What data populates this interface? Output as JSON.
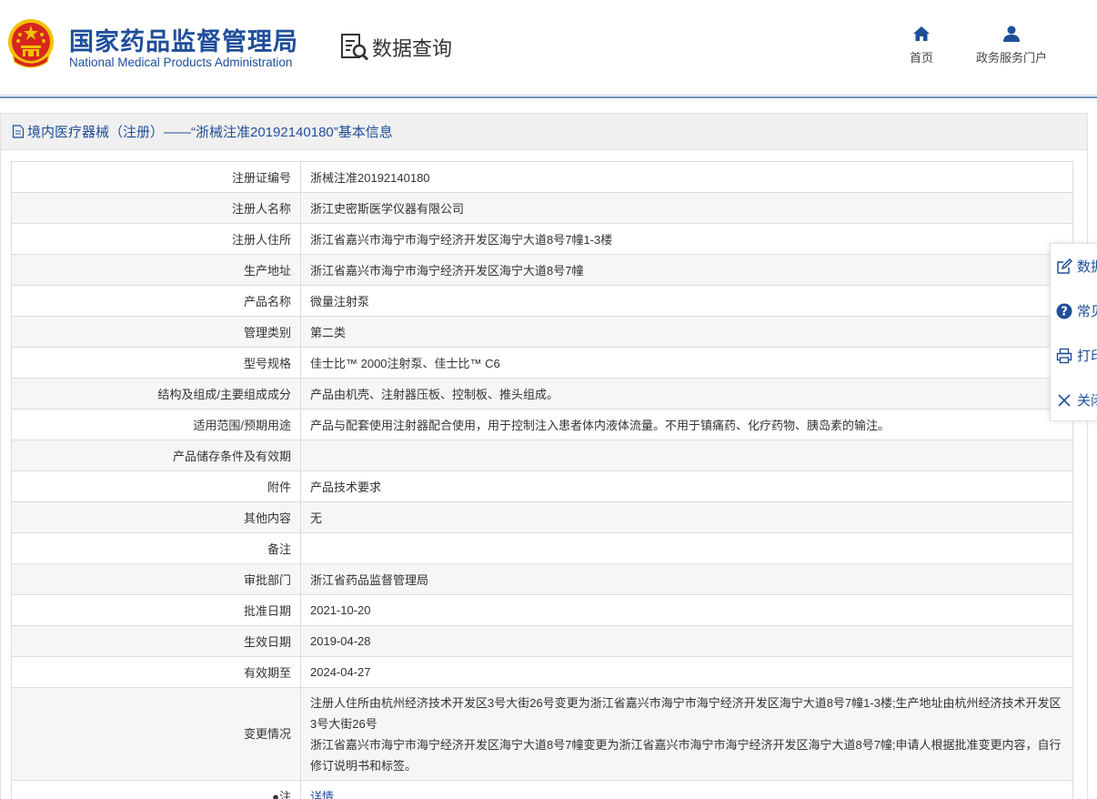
{
  "header": {
    "org_cn": "国家药品监督管理局",
    "org_en": "National Medical Products Administration",
    "query_label": "数据查询",
    "nav": [
      {
        "label": "首页",
        "icon": "home-icon"
      },
      {
        "label": "政务服务门户",
        "icon": "user-icon"
      }
    ]
  },
  "panel": {
    "title": "境内医疗器械（注册）——“浙械注准20192140180”基本信息"
  },
  "rows": [
    {
      "label": "注册证编号",
      "value": "浙械注准20192140180"
    },
    {
      "label": "注册人名称",
      "value": "浙江史密斯医学仪器有限公司"
    },
    {
      "label": "注册人住所",
      "value": "浙江省嘉兴市海宁市海宁经济开发区海宁大道8号7幢1-3楼"
    },
    {
      "label": "生产地址",
      "value": "浙江省嘉兴市海宁市海宁经济开发区海宁大道8号7幢"
    },
    {
      "label": "产品名称",
      "value": "微量注射泵"
    },
    {
      "label": "管理类别",
      "value": "第二类"
    },
    {
      "label": "型号规格",
      "value": "佳士比™ 2000注射泵、佳士比™ C6"
    },
    {
      "label": "结构及组成/主要组成成分",
      "value": "产品由机壳、注射器压板、控制板、推头组成。"
    },
    {
      "label": "适用范围/预期用途",
      "value": "产品与配套使用注射器配合使用，用于控制注入患者体内液体流量。不用于镇痛药、化疗药物、胰岛素的输注。"
    },
    {
      "label": "产品储存条件及有效期",
      "value": ""
    },
    {
      "label": "附件",
      "value": "产品技术要求"
    },
    {
      "label": "其他内容",
      "value": "无"
    },
    {
      "label": "备注",
      "value": ""
    },
    {
      "label": "审批部门",
      "value": "浙江省药品监督管理局"
    },
    {
      "label": "批准日期",
      "value": "2021-10-20"
    },
    {
      "label": "生效日期",
      "value": "2019-04-28"
    },
    {
      "label": "有效期至",
      "value": "2024-04-27"
    }
  ],
  "change": {
    "label": "变更情况",
    "line1": "注册人住所由杭州经济技术开发区3号大街26号变更为浙江省嘉兴市海宁市海宁经济开发区海宁大道8号7幢1-3楼;生产地址由杭州经济技术开发区3号大街26号",
    "line2": "浙江省嘉兴市海宁市海宁经济开发区海宁大道8号7幢变更为浙江省嘉兴市海宁市海宁经济开发区海宁大道8号7幢;申请人根据批准变更内容，自行修订说明书和标签。"
  },
  "note_row": {
    "label": "●注",
    "value": "详情"
  },
  "sidebar": [
    {
      "label": "数据",
      "icon": "edit-icon"
    },
    {
      "label": "常见",
      "icon": "help-icon"
    },
    {
      "label": "打印",
      "icon": "print-icon"
    },
    {
      "label": "关闭",
      "icon": "close-icon"
    }
  ],
  "colors": {
    "brand_blue": "#1f4e9a",
    "emblem_red": "#d7261e",
    "emblem_gold": "#f2c200"
  }
}
